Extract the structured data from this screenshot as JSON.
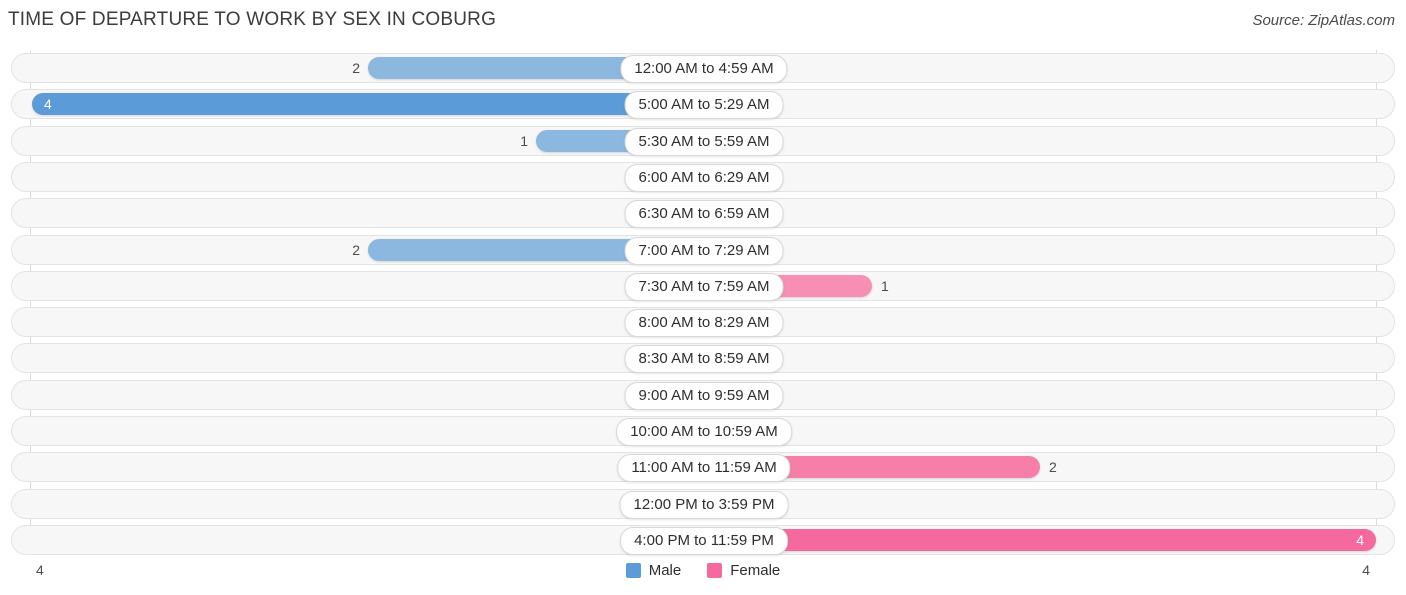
{
  "header": {
    "title": "TIME OF DEPARTURE TO WORK BY SEX IN COBURG",
    "source": "Source: ZipAtlas.com"
  },
  "legend": {
    "items": [
      {
        "label": "Male",
        "color": "#5b9bd8"
      },
      {
        "label": "Female",
        "color": "#f4699e"
      }
    ]
  },
  "axis": {
    "left_label": "4",
    "right_label": "4"
  },
  "colors": {
    "male_high": "#5b9bd8",
    "male_mid": "#8cb8e0",
    "male_zero": "#a8c8ea",
    "female_high": "#f4699e",
    "female_mid": "#f57fa8",
    "female_low": "#f78fb4",
    "female_zero": "#f8aac6",
    "row_bg": "#f7f7f7",
    "row_border": "#e3e3e3",
    "grid": "#dadada",
    "title": "#3c3c3c"
  },
  "chart_data": {
    "type": "bar",
    "title": "TIME OF DEPARTURE TO WORK BY SEX IN COBURG",
    "orientation": "horizontal-diverging",
    "xlabel": "",
    "ylabel": "",
    "xlim": [
      4,
      4
    ],
    "grid": true,
    "legend_position": "bottom-center",
    "categories": [
      "12:00 AM to 4:59 AM",
      "5:00 AM to 5:29 AM",
      "5:30 AM to 5:59 AM",
      "6:00 AM to 6:29 AM",
      "6:30 AM to 6:59 AM",
      "7:00 AM to 7:29 AM",
      "7:30 AM to 7:59 AM",
      "8:00 AM to 8:29 AM",
      "8:30 AM to 8:59 AM",
      "9:00 AM to 9:59 AM",
      "10:00 AM to 10:59 AM",
      "11:00 AM to 11:59 AM",
      "12:00 PM to 3:59 PM",
      "4:00 PM to 11:59 PM"
    ],
    "series": [
      {
        "name": "Male",
        "values": [
          2,
          4,
          1,
          0,
          0,
          2,
          0,
          0,
          0,
          0,
          0,
          0,
          0,
          0
        ]
      },
      {
        "name": "Female",
        "values": [
          0,
          0,
          0,
          0,
          0,
          0,
          1,
          0,
          0,
          0,
          0,
          2,
          0,
          4
        ]
      }
    ]
  }
}
